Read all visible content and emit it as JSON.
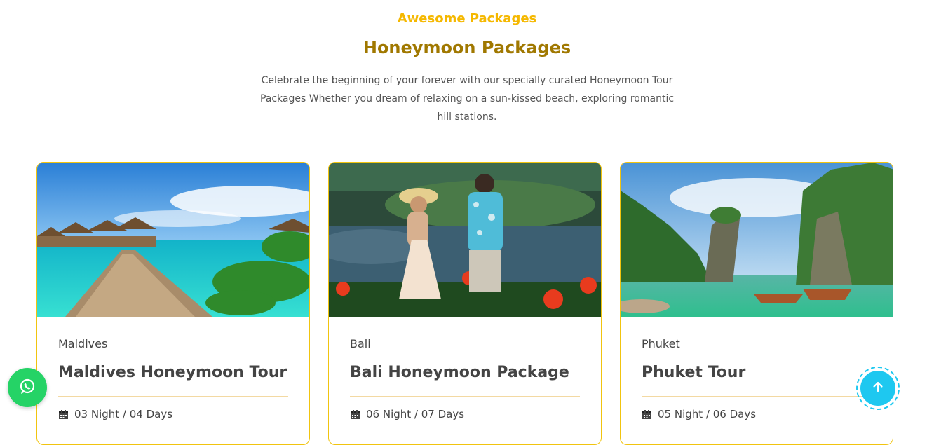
{
  "section": {
    "eyebrow": "Awesome Packages",
    "title": "Honeymoon Packages",
    "intro": "Celebrate the beginning of your forever with our specially curated Honeymoon Tour Packages Whether you dream of relaxing on a sun-kissed beach, exploring romantic hill stations."
  },
  "packages": [
    {
      "location": "Maldives",
      "title": "Maldives Honeymoon Tour",
      "duration": "03 Night / 04 Days",
      "image": "maldives-overwater-villas"
    },
    {
      "location": "Bali",
      "title": "Bali Honeymoon Package",
      "duration": "06 Night / 07 Days",
      "image": "bali-couple-lake"
    },
    {
      "location": "Phuket",
      "title": "Phuket Tour",
      "duration": "05 Night / 06 Days",
      "image": "phuket-limestone-boats"
    }
  ],
  "icons": {
    "calendar": "calendar-icon",
    "whatsapp": "whatsapp-icon",
    "scroll_top": "arrow-up-icon"
  },
  "colors": {
    "accent": "#f5b800",
    "title": "#a07800",
    "card_border": "#f1c40f",
    "whatsapp": "#25d366",
    "scroll_top": "#1ec8f0"
  }
}
